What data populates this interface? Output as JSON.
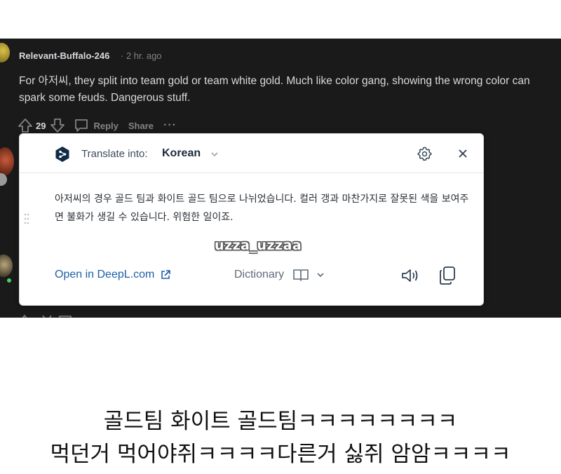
{
  "comment": {
    "username": "Relevant-Buffalo-246",
    "meta": "· 2 hr. ago",
    "body": "For 아저씨, they split into team gold or team white gold. Much like color gang, showing the wrong color can spark some feuds. Dangerous stuff.",
    "votes": "29",
    "reply_label": "Reply",
    "share_label": "Share",
    "more_label": "···"
  },
  "translator": {
    "translate_into_label": "Translate into:",
    "target_language": "Korean",
    "translated_text": "아저씨의 경우 골드 팀과 화이트 골드 팀으로 나뉘었습니다. 컬러 갱과 마찬가지로 잘못된 색을 보여주면 불화가 생길 수 있습니다. 위험한 일이죠.",
    "open_link_label": "Open in DeepL.com",
    "dictionary_label": "Dictionary"
  },
  "watermark": "uzza_uzzaa",
  "caption": {
    "line1": "골드팀 화이트 골드팀ㅋㅋㅋㅋㅋㅋㅋㅋ",
    "line2": "먹던거 먹어야쥐ㅋㅋㅋㅋ다른거 싫쥐 암암ㅋㅋㅋㅋ"
  },
  "colors": {
    "dark_background": "#1a1a1b",
    "link_blue": "#1d5fa8",
    "deepl_navy": "#0f2b46"
  }
}
